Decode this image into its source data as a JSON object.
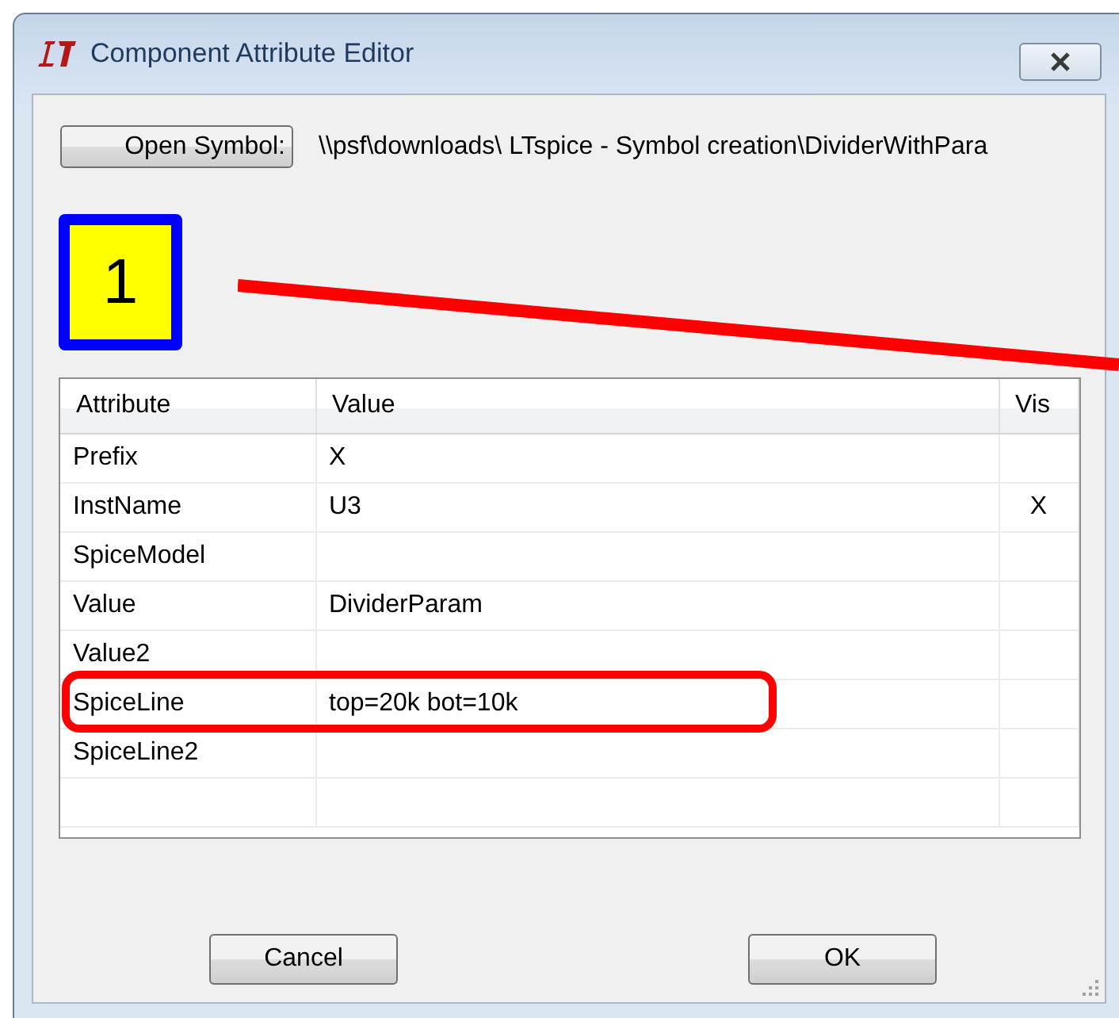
{
  "window": {
    "title": "Component Attribute Editor"
  },
  "open_symbol_button": "Open Symbol:",
  "symbol_path": "\\\\psf\\downloads\\ LTspice - Symbol creation\\DividerWithPara",
  "callout_badge": "1",
  "table": {
    "columns": [
      "Attribute",
      "Value",
      "Vis"
    ],
    "rows": [
      {
        "attribute": "Prefix",
        "value": "X",
        "vis": "",
        "highlighted": false
      },
      {
        "attribute": "InstName",
        "value": "U3",
        "vis": "X",
        "highlighted": false
      },
      {
        "attribute": "SpiceModel",
        "value": "",
        "vis": "",
        "highlighted": false
      },
      {
        "attribute": "Value",
        "value": "DividerParam",
        "vis": "",
        "highlighted": false
      },
      {
        "attribute": "Value2",
        "value": "",
        "vis": "",
        "highlighted": false
      },
      {
        "attribute": "SpiceLine",
        "value": "top=20k bot=10k",
        "vis": "",
        "highlighted": true
      },
      {
        "attribute": "SpiceLine2",
        "value": "",
        "vis": "",
        "highlighted": false
      },
      {
        "attribute": "",
        "value": "",
        "vis": "",
        "highlighted": false
      }
    ]
  },
  "buttons": [
    "Cancel",
    "OK"
  ]
}
